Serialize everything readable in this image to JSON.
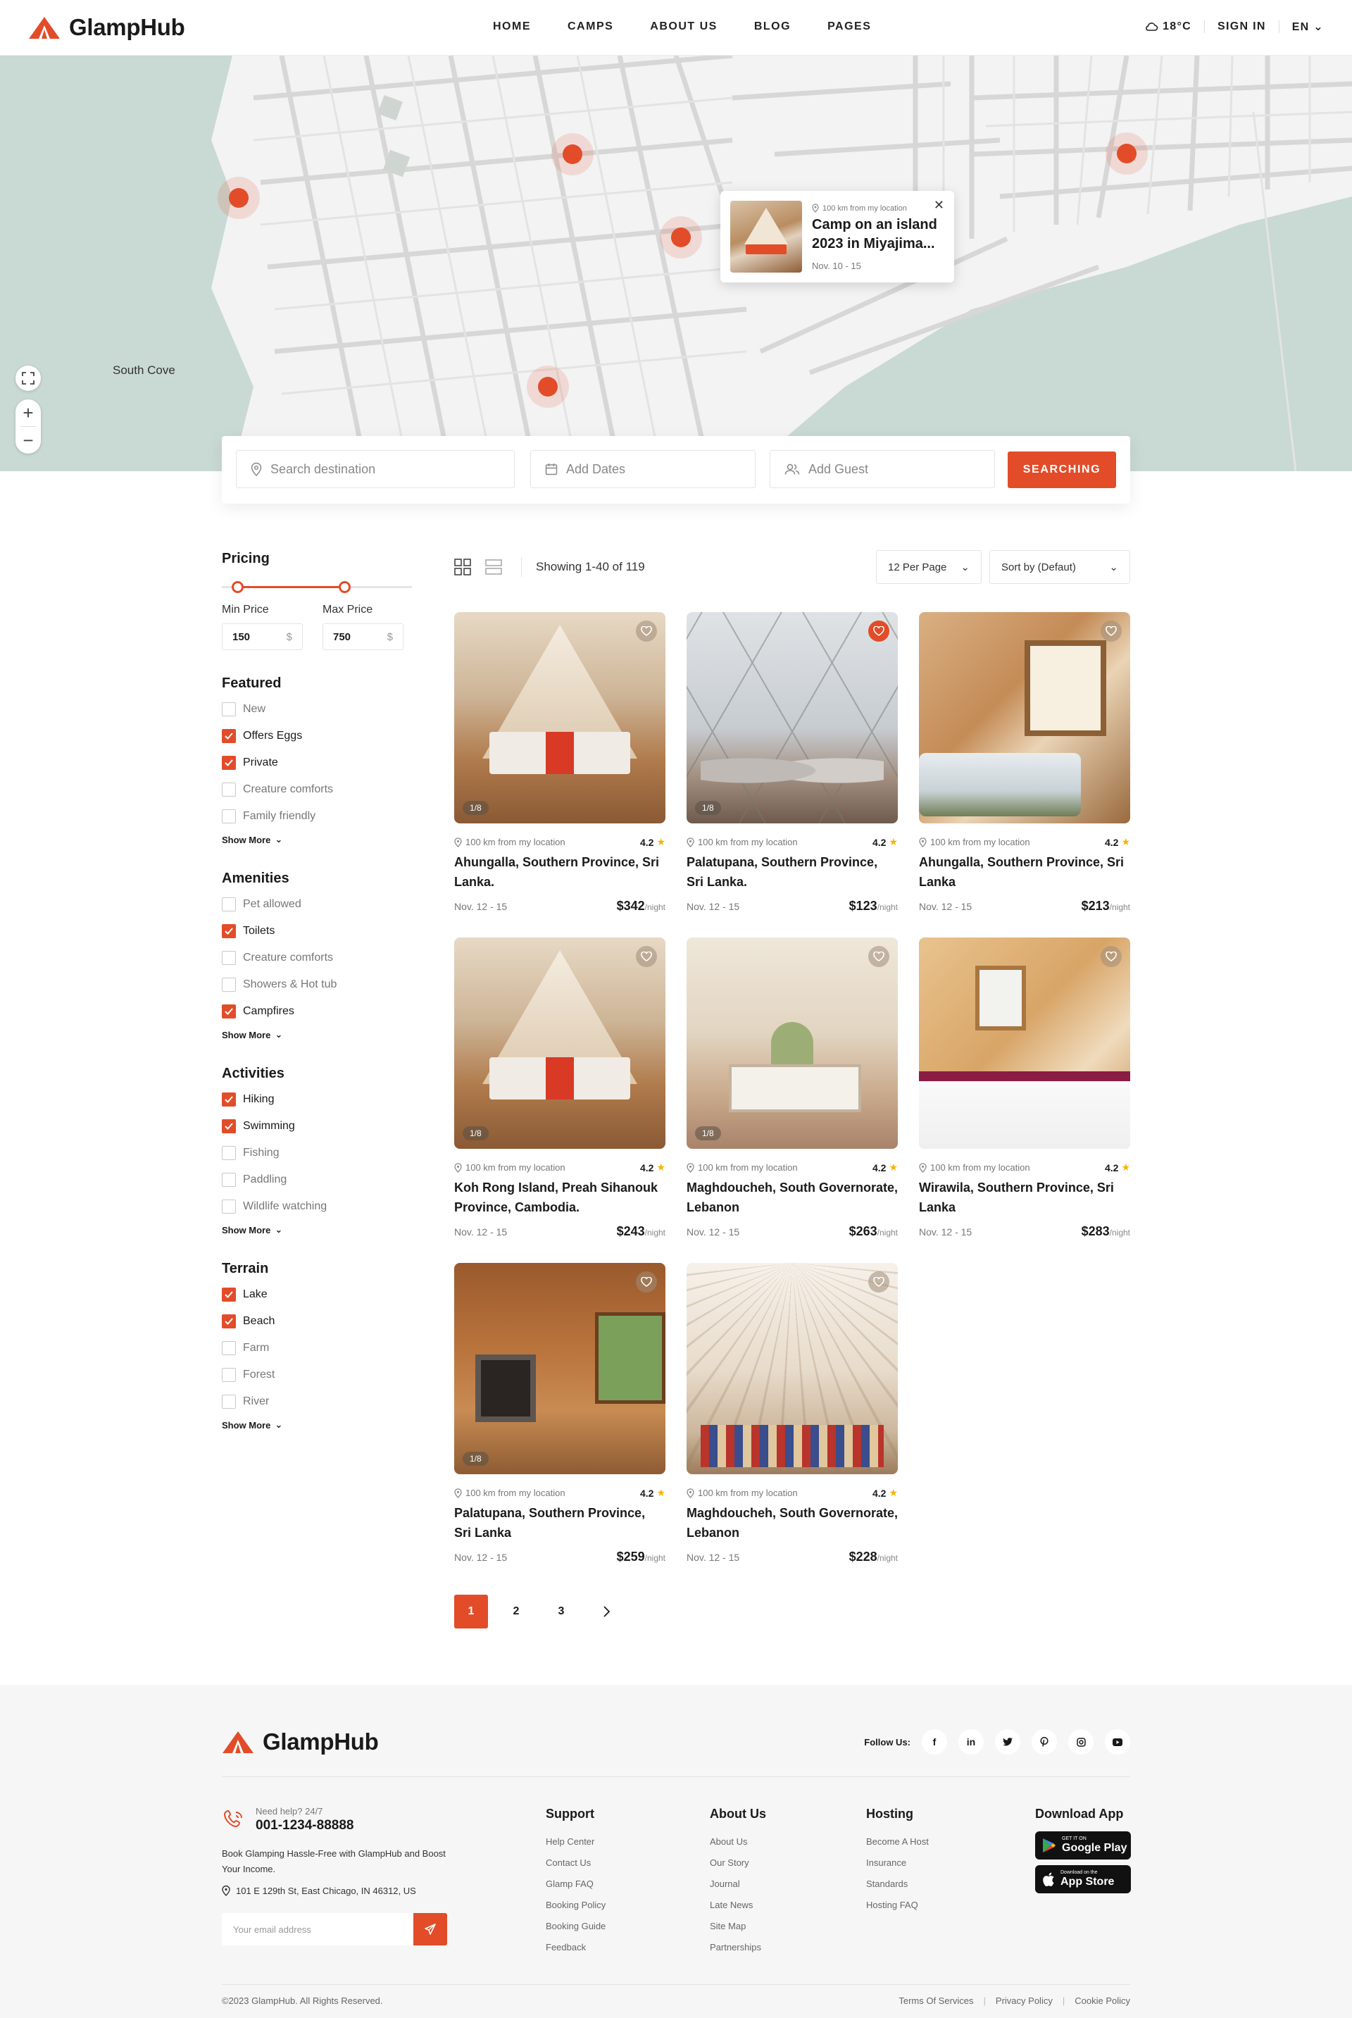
{
  "brand": {
    "name": "GlampHub",
    "accent": "#e24c29"
  },
  "nav": [
    "HOME",
    "CAMPS",
    "ABOUT US",
    "BLOG",
    "PAGES"
  ],
  "header": {
    "weather": "18°C",
    "sign_in": "SIGN IN",
    "language": "EN"
  },
  "map": {
    "label_south_cove": "South Cove",
    "popup": {
      "distance": "100 km from my location",
      "title": "Camp on an island 2023 in Miyajima...",
      "date": "Nov. 10 - 15"
    }
  },
  "search": {
    "destination_placeholder": "Search destination",
    "dates_placeholder": "Add Dates",
    "guest_placeholder": "Add Guest",
    "button": "SEARCHING"
  },
  "filters": {
    "pricing_title": "Pricing",
    "min_label": "Min Price",
    "max_label": "Max Price",
    "min_value": "150",
    "max_value": "750",
    "currency": "$",
    "show_more": "Show More",
    "groups": [
      {
        "title": "Featured",
        "options": [
          {
            "label": "New",
            "checked": false
          },
          {
            "label": "Offers Eggs",
            "checked": true
          },
          {
            "label": "Private",
            "checked": true
          },
          {
            "label": "Creature comforts",
            "checked": false
          },
          {
            "label": "Family friendly",
            "checked": false
          }
        ]
      },
      {
        "title": "Amenities",
        "options": [
          {
            "label": "Pet allowed",
            "checked": false
          },
          {
            "label": "Toilets",
            "checked": true
          },
          {
            "label": "Creature comforts",
            "checked": false
          },
          {
            "label": "Showers & Hot tub",
            "checked": false
          },
          {
            "label": "Campfires",
            "checked": true
          }
        ]
      },
      {
        "title": "Activities",
        "options": [
          {
            "label": "Hiking",
            "checked": true
          },
          {
            "label": "Swimming",
            "checked": true
          },
          {
            "label": "Fishing",
            "checked": false
          },
          {
            "label": "Paddling",
            "checked": false
          },
          {
            "label": "Wildlife watching",
            "checked": false
          }
        ]
      },
      {
        "title": "Terrain",
        "options": [
          {
            "label": "Lake",
            "checked": true
          },
          {
            "label": "Beach",
            "checked": true
          },
          {
            "label": "Farm",
            "checked": false
          },
          {
            "label": "Forest",
            "checked": false
          },
          {
            "label": "River",
            "checked": false
          }
        ]
      }
    ]
  },
  "results": {
    "summary": "Showing 1-40 of 119",
    "per_page": "12 Per Page",
    "sort": "Sort by (Defaut)",
    "per_night": "/night",
    "listings": [
      {
        "img": "tent",
        "fav": false,
        "photos": "1/8",
        "distance": "100 km from my location",
        "rating": "4.2",
        "title": "Ahungalla, Southern Province, Sri Lanka.",
        "dates": "Nov. 12 - 15",
        "price": "$342"
      },
      {
        "img": "dome",
        "fav": true,
        "photos": "1/8",
        "distance": "100 km from my location",
        "rating": "4.2",
        "title": "Palatupana, Southern Province, Sri Lanka.",
        "dates": "Nov. 12 - 15",
        "price": "$123"
      },
      {
        "img": "cabin",
        "fav": false,
        "photos": "1/8",
        "distance": "100 km from my location",
        "rating": "4.2",
        "title": "Ahungalla, Southern Province, Sri Lanka",
        "dates": "Nov. 12 - 15",
        "price": "$213"
      },
      {
        "img": "tent",
        "fav": false,
        "photos": "1/8",
        "distance": "100 km from my location",
        "rating": "4.2",
        "title": "Koh Rong Island, Preah Sihanouk Province, Cambodia.",
        "dates": "Nov. 12 - 15",
        "price": "$243"
      },
      {
        "img": "bell",
        "fav": false,
        "photos": "1/8",
        "distance": "100 km from my location",
        "rating": "4.2",
        "title": "Maghdoucheh, South Governorate, Lebanon",
        "dates": "Nov. 12 - 15",
        "price": "$263"
      },
      {
        "img": "wood",
        "fav": false,
        "photos": "1/8",
        "distance": "100 km from my location",
        "rating": "4.2",
        "title": "Wirawila, Southern Province, Sri Lanka",
        "dates": "Nov. 12 - 15",
        "price": "$283"
      },
      {
        "img": "lodge",
        "fav": false,
        "photos": "1/8",
        "distance": "100 km from my location",
        "rating": "4.2",
        "title": "Palatupana, Southern Province, Sri Lanka",
        "dates": "Nov. 12 - 15",
        "price": "$259"
      },
      {
        "img": "tipi",
        "fav": false,
        "photos": "",
        "distance": "100 km from my location",
        "rating": "4.2",
        "title": "Maghdoucheh, South Governorate, Lebanon",
        "dates": "Nov. 12 - 15",
        "price": "$228"
      }
    ]
  },
  "pagination": {
    "pages": [
      "1",
      "2",
      "3"
    ],
    "current": "1"
  },
  "footer": {
    "follow": "Follow Us:",
    "social": [
      "f",
      "in",
      "tw",
      "p",
      "ig",
      "yt"
    ],
    "help_small": "Need help? 24/7",
    "phone": "001-1234-88888",
    "desc": "Book Glamping Hassle-Free with GlampHub and Boost Your Income.",
    "address": "101 E 129th St, East Chicago, IN 46312, US",
    "email_placeholder": "Your email address",
    "columns": [
      {
        "title": "Support",
        "links": [
          "Help Center",
          "Contact Us",
          "Glamp FAQ",
          "Booking Policy",
          "Booking Guide",
          "Feedback"
        ]
      },
      {
        "title": "About Us",
        "links": [
          "About Us",
          "Our Story",
          "Journal",
          "Late News",
          "Site Map",
          "Partnerships"
        ]
      },
      {
        "title": "Hosting",
        "links": [
          "Become A Host",
          "Insurance",
          "Standards",
          "Hosting FAQ"
        ]
      }
    ],
    "download_title": "Download App",
    "google_small": "GET IT ON",
    "google_big": "Google Play",
    "apple_small": "Download on the",
    "apple_big": "App Store",
    "copyright": "©2023 GlampHub. All Rights Reserved.",
    "legal": [
      "Terms Of Services",
      "Privacy Policy",
      "Cookie Policy"
    ]
  }
}
